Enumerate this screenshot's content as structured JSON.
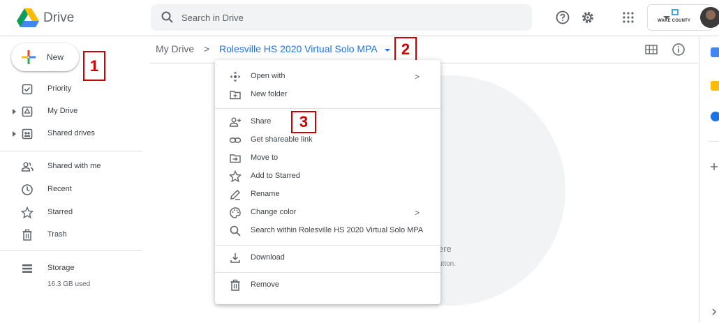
{
  "header": {
    "app_name": "Drive",
    "search_placeholder": "Search in Drive",
    "org_name": "WAKE COUNTY"
  },
  "sidebar": {
    "new_label": "New",
    "items": [
      {
        "label": "Priority",
        "icon": "priority-icon"
      },
      {
        "label": "My Drive",
        "icon": "my-drive-icon"
      },
      {
        "label": "Shared drives",
        "icon": "shared-drives-icon"
      },
      {
        "label": "Shared with me",
        "icon": "people-icon"
      },
      {
        "label": "Recent",
        "icon": "clock-icon"
      },
      {
        "label": "Starred",
        "icon": "star-icon"
      },
      {
        "label": "Trash",
        "icon": "trash-icon"
      }
    ],
    "storage_label": "Storage",
    "storage_used": "16.3 GB used"
  },
  "breadcrumb": {
    "root": "My Drive",
    "separator": ">",
    "current": "Rolesville HS 2020 Virtual Solo MPA"
  },
  "empty_state": {
    "partial_line1": "ere",
    "partial_line2": "utton."
  },
  "context_menu": {
    "items": [
      {
        "label": "Open with",
        "icon": "open-with-icon",
        "submenu": true
      },
      {
        "label": "New folder",
        "icon": "new-folder-icon"
      },
      {
        "label": "Share",
        "icon": "share-icon"
      },
      {
        "label": "Get shareable link",
        "icon": "link-icon"
      },
      {
        "label": "Move to",
        "icon": "move-to-icon"
      },
      {
        "label": "Add to Starred",
        "icon": "star-icon"
      },
      {
        "label": "Rename",
        "icon": "rename-icon"
      },
      {
        "label": "Change color",
        "icon": "palette-icon",
        "submenu": true
      },
      {
        "label": "Search within Rolesville HS 2020 Virtual Solo MPA",
        "icon": "search-icon"
      },
      {
        "label": "Download",
        "icon": "download-icon"
      },
      {
        "label": "Remove",
        "icon": "trash-icon"
      }
    ],
    "submenu_glyph": ">"
  },
  "callouts": [
    "1",
    "2",
    "3"
  ],
  "colors": {
    "accent_blue": "#1a73e8",
    "callout_red": "#cc0000",
    "text": "#3c4043"
  }
}
